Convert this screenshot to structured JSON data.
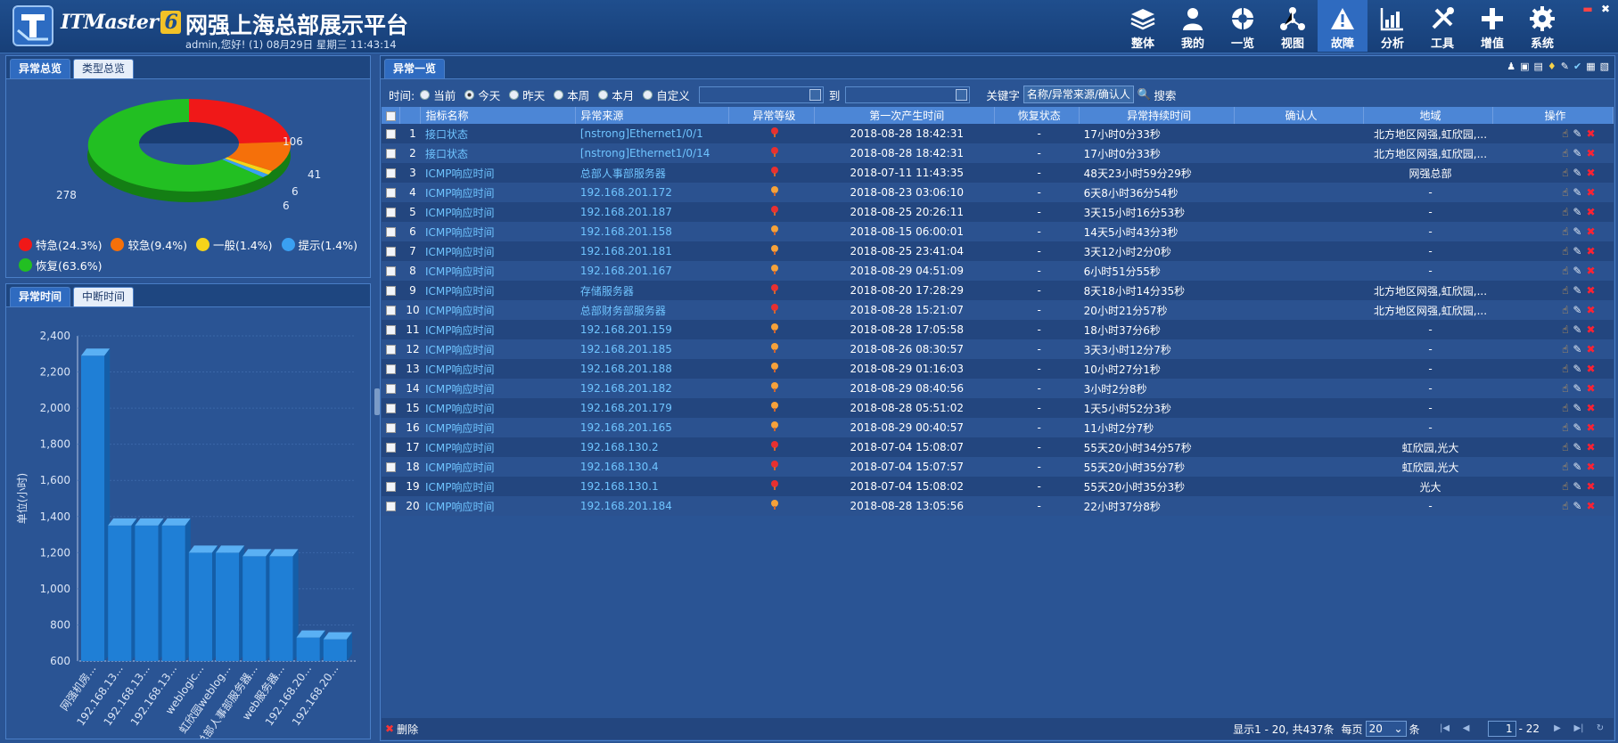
{
  "header": {
    "brand": "ITMaster",
    "brand_version": "6",
    "title": "网强上海总部展示平台",
    "subtitle": "admin,您好! (1) 08月29日 星期三 11:43:14",
    "nav": [
      {
        "label": "整体",
        "icon": "layers-icon"
      },
      {
        "label": "我的",
        "icon": "user-icon"
      },
      {
        "label": "一览",
        "icon": "overview-icon"
      },
      {
        "label": "视图",
        "icon": "topology-icon"
      },
      {
        "label": "故障",
        "icon": "warning-icon",
        "active": true
      },
      {
        "label": "分析",
        "icon": "chart-icon"
      },
      {
        "label": "工具",
        "icon": "tools-icon"
      },
      {
        "label": "增值",
        "icon": "plus-icon"
      },
      {
        "label": "系统",
        "icon": "gear-icon"
      }
    ]
  },
  "left_top": {
    "tabs": [
      "异常总览",
      "类型总览"
    ],
    "labels": {
      "red": "106",
      "orange": "41",
      "yellow": "6",
      "blue": "6",
      "green": "278"
    },
    "legend": [
      {
        "label": "特急(24.3%)",
        "color": "#f01818"
      },
      {
        "label": "较急(9.4%)",
        "color": "#f5700a"
      },
      {
        "label": "一般(1.4%)",
        "color": "#f5d31a"
      },
      {
        "label": "提示(1.4%)",
        "color": "#3aa0f2"
      },
      {
        "label": "恢复(63.6%)",
        "color": "#22bf22"
      }
    ]
  },
  "left_bottom": {
    "tabs": [
      "异常时间",
      "中断时间"
    ]
  },
  "chart_data": {
    "type": "bar",
    "ylabel": "单位(小时)",
    "ylim": [
      600,
      2400
    ],
    "ticks": [
      "2,400",
      "2,200",
      "2,000",
      "1,800",
      "1,600",
      "1,400",
      "1,200",
      "1,000",
      "800",
      "600"
    ],
    "categories": [
      "网强机房...",
      "192.168.13...",
      "192.168.13...",
      "192.168.13...",
      "weblogic...",
      "虹欣园weblog...",
      "总部人事部服务器...",
      "web服务器...",
      "192.168.20...",
      "192.168.20..."
    ],
    "values": [
      2290,
      1350,
      1350,
      1350,
      1200,
      1200,
      1180,
      1180,
      730,
      720
    ]
  },
  "main": {
    "tab": "异常一览",
    "filter": {
      "time_label": "时间:",
      "options": [
        "当前",
        "今天",
        "昨天",
        "本周",
        "本月",
        "自定义"
      ],
      "selected": 1,
      "to_label": "到",
      "keyword_label": "关键字",
      "keyword_placeholder": "名称/异常来源/确认人",
      "search_label": "搜索"
    },
    "columns": [
      "",
      "",
      "指标名称",
      "异常来源",
      "异常等级",
      "第一次产生时间",
      "恢复状态",
      "异常持续时间",
      "确认人",
      "地域",
      "操作"
    ],
    "rows": [
      {
        "no": "1",
        "name": "接口状态",
        "source": "[nstrong]Ethernet1/0/1",
        "level": "red",
        "time": "2018-08-28 18:42:31",
        "status": "-",
        "duration": "17小时0分33秒",
        "confirm": "",
        "region": "北方地区网强,虹欣园,..."
      },
      {
        "no": "2",
        "name": "接口状态",
        "source": "[nstrong]Ethernet1/0/14",
        "level": "red",
        "time": "2018-08-28 18:42:31",
        "status": "-",
        "duration": "17小时0分33秒",
        "confirm": "",
        "region": "北方地区网强,虹欣园,..."
      },
      {
        "no": "3",
        "name": "ICMP响应时间",
        "source": "总部人事部服务器",
        "level": "red",
        "time": "2018-07-11 11:43:35",
        "status": "-",
        "duration": "48天23小时59分29秒",
        "confirm": "",
        "region": "网强总部"
      },
      {
        "no": "4",
        "name": "ICMP响应时间",
        "source": "192.168.201.172",
        "level": "orange",
        "time": "2018-08-23 03:06:10",
        "status": "-",
        "duration": "6天8小时36分54秒",
        "confirm": "",
        "region": "-"
      },
      {
        "no": "5",
        "name": "ICMP响应时间",
        "source": "192.168.201.187",
        "level": "red",
        "time": "2018-08-25 20:26:11",
        "status": "-",
        "duration": "3天15小时16分53秒",
        "confirm": "",
        "region": "-"
      },
      {
        "no": "6",
        "name": "ICMP响应时间",
        "source": "192.168.201.158",
        "level": "orange",
        "time": "2018-08-15 06:00:01",
        "status": "-",
        "duration": "14天5小时43分3秒",
        "confirm": "",
        "region": "-"
      },
      {
        "no": "7",
        "name": "ICMP响应时间",
        "source": "192.168.201.181",
        "level": "orange",
        "time": "2018-08-25 23:41:04",
        "status": "-",
        "duration": "3天12小时2分0秒",
        "confirm": "",
        "region": "-"
      },
      {
        "no": "8",
        "name": "ICMP响应时间",
        "source": "192.168.201.167",
        "level": "orange",
        "time": "2018-08-29 04:51:09",
        "status": "-",
        "duration": "6小时51分55秒",
        "confirm": "",
        "region": "-"
      },
      {
        "no": "9",
        "name": "ICMP响应时间",
        "source": "存储服务器",
        "level": "red",
        "time": "2018-08-20 17:28:29",
        "status": "-",
        "duration": "8天18小时14分35秒",
        "confirm": "",
        "region": "北方地区网强,虹欣园,..."
      },
      {
        "no": "10",
        "name": "ICMP响应时间",
        "source": "总部财务部服务器",
        "level": "red",
        "time": "2018-08-28 15:21:07",
        "status": "-",
        "duration": "20小时21分57秒",
        "confirm": "",
        "region": "北方地区网强,虹欣园,..."
      },
      {
        "no": "11",
        "name": "ICMP响应时间",
        "source": "192.168.201.159",
        "level": "orange",
        "time": "2018-08-28 17:05:58",
        "status": "-",
        "duration": "18小时37分6秒",
        "confirm": "",
        "region": "-"
      },
      {
        "no": "12",
        "name": "ICMP响应时间",
        "source": "192.168.201.185",
        "level": "orange",
        "time": "2018-08-26 08:30:57",
        "status": "-",
        "duration": "3天3小时12分7秒",
        "confirm": "",
        "region": "-"
      },
      {
        "no": "13",
        "name": "ICMP响应时间",
        "source": "192.168.201.188",
        "level": "orange",
        "time": "2018-08-29 01:16:03",
        "status": "-",
        "duration": "10小时27分1秒",
        "confirm": "",
        "region": "-"
      },
      {
        "no": "14",
        "name": "ICMP响应时间",
        "source": "192.168.201.182",
        "level": "orange",
        "time": "2018-08-29 08:40:56",
        "status": "-",
        "duration": "3小时2分8秒",
        "confirm": "",
        "region": "-"
      },
      {
        "no": "15",
        "name": "ICMP响应时间",
        "source": "192.168.201.179",
        "level": "orange",
        "time": "2018-08-28 05:51:02",
        "status": "-",
        "duration": "1天5小时52分3秒",
        "confirm": "",
        "region": "-"
      },
      {
        "no": "16",
        "name": "ICMP响应时间",
        "source": "192.168.201.165",
        "level": "orange",
        "time": "2018-08-29 00:40:57",
        "status": "-",
        "duration": "11小时2分7秒",
        "confirm": "",
        "region": "-"
      },
      {
        "no": "17",
        "name": "ICMP响应时间",
        "source": "192.168.130.2",
        "level": "red",
        "time": "2018-07-04 15:08:07",
        "status": "-",
        "duration": "55天20小时34分57秒",
        "confirm": "",
        "region": "虹欣园,光大"
      },
      {
        "no": "18",
        "name": "ICMP响应时间",
        "source": "192.168.130.4",
        "level": "red",
        "time": "2018-07-04 15:07:57",
        "status": "-",
        "duration": "55天20小时35分7秒",
        "confirm": "",
        "region": "虹欣园,光大"
      },
      {
        "no": "19",
        "name": "ICMP响应时间",
        "source": "192.168.130.1",
        "level": "red",
        "time": "2018-07-04 15:08:02",
        "status": "-",
        "duration": "55天20小时35分3秒",
        "confirm": "",
        "region": "光大"
      },
      {
        "no": "20",
        "name": "ICMP响应时间",
        "source": "192.168.201.184",
        "level": "orange",
        "time": "2018-08-28 13:05:56",
        "status": "-",
        "duration": "22小时37分8秒",
        "confirm": "",
        "region": "-"
      }
    ],
    "footer": {
      "delete_label": "删除",
      "range_text": "显示1 - 20, 共437条",
      "per_page_label": "每页",
      "per_page": "20",
      "per_page_unit": "条",
      "page": "1",
      "page_total": "- 22"
    }
  }
}
